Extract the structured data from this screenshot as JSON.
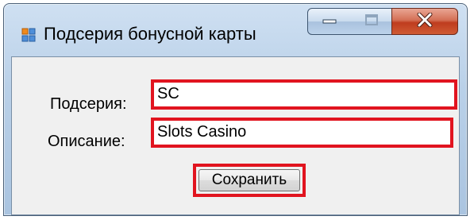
{
  "window": {
    "title": "Подсерия бонусной карты",
    "icon": "form-window-icon",
    "controls": {
      "minimize": "minimize-icon",
      "maximize": "maximize-icon",
      "close": "close-icon"
    }
  },
  "form": {
    "subseries_label": "Подсерия:",
    "subseries_value": "SC",
    "description_label": "Описание:",
    "description_value": "Slots Casino",
    "save_label": "Сохранить"
  },
  "colors": {
    "highlight": "#e1141f",
    "titlebar": "#b9d0e8",
    "client": "#f0f0f0"
  }
}
